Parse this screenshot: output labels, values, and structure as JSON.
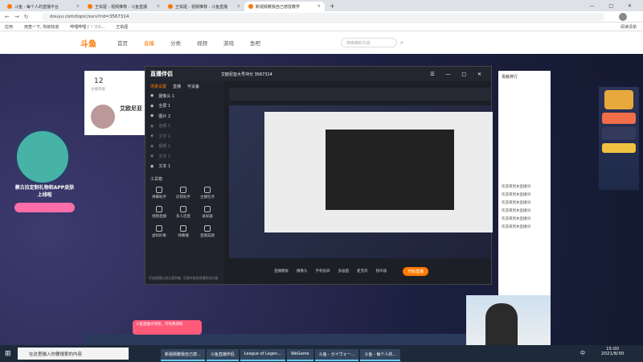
{
  "browser": {
    "tabs": [
      {
        "title": "斗鱼 - 每个人的直播平台",
        "color": "#ff7700"
      },
      {
        "title": "王佑娅 - 视频推荐 - 斗鱼直播",
        "color": "#ff7700"
      },
      {
        "title": "王佑娅 - 视频推荐 - 斗鱼直播",
        "color": "#ff7700"
      },
      {
        "title": "新视频教我自己感冒教学",
        "color": "#ff7700"
      }
    ],
    "url": "douyu.com/topic/xsrs?rid=3567314",
    "bookmarks": [
      "应用",
      "用查一下, 你就知道",
      "哔哩哔哩 ( '- ')つ...",
      "王佑娅"
    ],
    "reading_list": "阅读清单"
  },
  "site": {
    "logo": "斗鱼",
    "nav": [
      "首页",
      "直播",
      "分类",
      "视频",
      "游戏",
      "鱼吧"
    ],
    "active_nav": "直播",
    "search_placeholder": "搜索精彩内容",
    "follow_count": "12",
    "follow_label": "主播等级",
    "streamer_name": "艾欧尼亚",
    "chat_header": "贡献排行",
    "chat_lines": [
      "欢迎来到本直播间",
      "欢迎来到本直播间",
      "欢迎来到本直播间",
      "欢迎来到本直播间",
      "欢迎来到本直播间",
      "欢迎来到本直播间"
    ],
    "left_banner_text": "蔡古拉定制礼物和APP皮肤上线啦",
    "promo_text": "斗鱼直播大师巡，可免费领取"
  },
  "obs": {
    "app_name": "直播伴侣",
    "room": "艾欧尼亚大号冲分 3567314",
    "tabs": [
      "场景设置",
      "直播",
      "可设备"
    ],
    "sources": [
      {
        "name": "摄像头 1",
        "dim": false
      },
      {
        "name": "全屏 1",
        "dim": false
      },
      {
        "name": "图片 2",
        "dim": false
      },
      {
        "name": "音频 1",
        "dim": true
      },
      {
        "name": "文字 1",
        "dim": true
      },
      {
        "name": "视频 1",
        "dim": true
      },
      {
        "name": "文字 1",
        "dim": true
      },
      {
        "name": "文本 1",
        "dim": false
      }
    ],
    "tools_label": "工具箱",
    "tools": [
      "弹幕助手",
      "房管助手",
      "主播任务",
      "视频直播",
      "多人连麦",
      "录屏器",
      "虚拟形象",
      "弹幕播",
      "直播美颜",
      "投屏",
      "更多工具",
      "调音器"
    ],
    "bottom_controls": [
      "直播模板",
      "摄像头",
      "手机投屏",
      "多画面",
      "麦克风",
      "扬声器"
    ],
    "start_live": "开始直播",
    "status_text": "开始直播后请注意防御, 可随时使用直播检测功能"
  },
  "taskbar": {
    "search_placeholder": "在这里输入你要搜索的内容",
    "apps": [
      "新视频教我自己感...",
      "斗鱼直播伴侣",
      "League of Legen...",
      "WeGame",
      "斗鱼 - ガイヴォー...",
      "斗鱼 - 每个人的..."
    ],
    "time": "15:00",
    "date": "2021/8/30",
    "lang": "中"
  }
}
